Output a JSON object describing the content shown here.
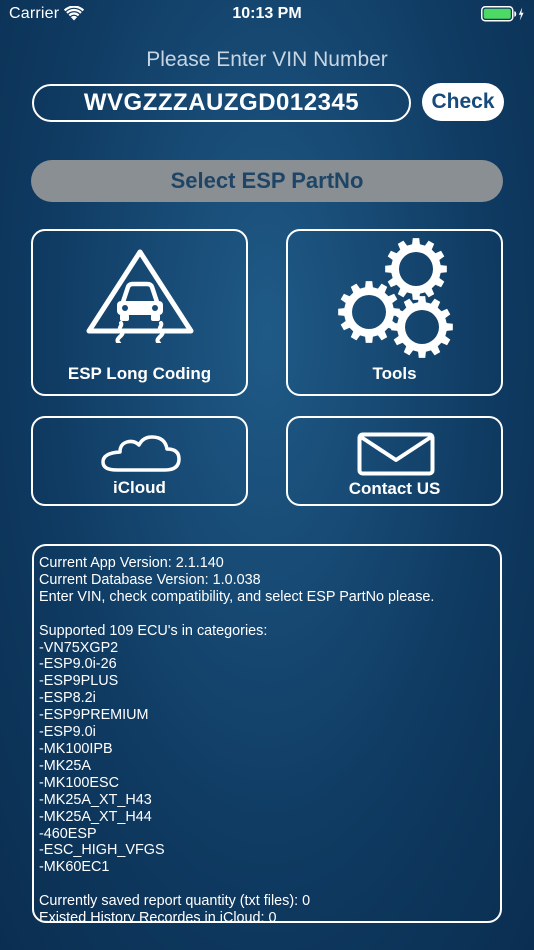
{
  "status_bar": {
    "carrier": "Carrier",
    "time": "10:13 PM",
    "wifi_icon": "wifi-icon",
    "battery_icon": "battery-charging-icon"
  },
  "vin": {
    "prompt": "Please Enter VIN Number",
    "value": "WVGZZZAUZGD012345",
    "check_label": "Check"
  },
  "select_partno": {
    "label": "Select ESP PartNo"
  },
  "tiles": {
    "esp_long_coding": {
      "label": "ESP Long Coding",
      "icon": "skidding-car-warning-icon"
    },
    "tools": {
      "label": "Tools",
      "icon": "gears-icon"
    },
    "icloud": {
      "label": "iCloud",
      "icon": "cloud-icon"
    },
    "contact": {
      "label": "Contact US",
      "icon": "envelope-icon"
    }
  },
  "info": {
    "lines": [
      "Current App Version: 2.1.140",
      "Current Database Version: 1.0.038",
      "Enter VIN, check compatibility, and select ESP PartNo please.",
      "",
      "Supported 109 ECU's in categories:",
      "-VN75XGP2",
      "-ESP9.0i-26",
      "-ESP9PLUS",
      "-ESP8.2i",
      "-ESP9PREMIUM",
      "-ESP9.0i",
      "-MK100IPB",
      "-MK25A",
      "-MK100ESC",
      "-MK25A_XT_H43",
      "-MK25A_XT_H44",
      "-460ESP",
      "-ESC_HIGH_VFGS",
      "-MK60EC1",
      "",
      "Currently saved report quantity (txt files): 0",
      "Existed History Recordes in iCloud: 0"
    ]
  },
  "colors": {
    "background": "#174a74",
    "check_text": "#174b7b",
    "select_bg": "#8a8f93",
    "select_text": "#1f4566",
    "battery_fill": "#4cd964"
  }
}
